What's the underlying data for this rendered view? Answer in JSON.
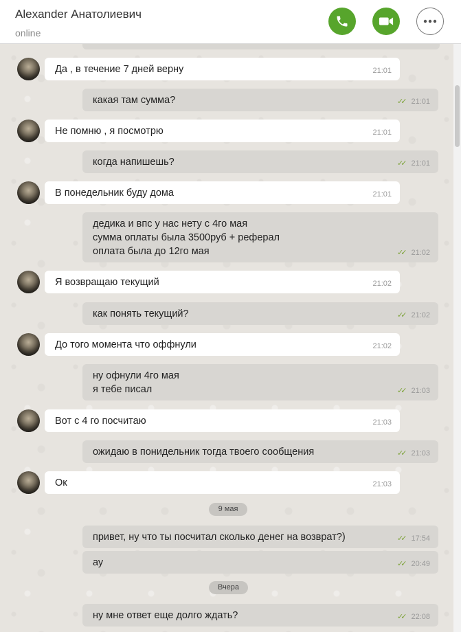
{
  "header": {
    "contact_name": "Alexander Анатолиевич",
    "status": "online",
    "call_icon": "phone-icon",
    "video_icon": "video-camera-icon",
    "more_icon": "more-dots-icon",
    "accent_color": "#57a52c"
  },
  "messages": [
    {
      "direction": "in",
      "text": "Да , в течение 7 дней верну",
      "time": "21:01"
    },
    {
      "direction": "out",
      "text": "какая там сумма?",
      "time": "21:01",
      "read": true
    },
    {
      "direction": "in",
      "text": "Не помню , я посмотрю",
      "time": "21:01"
    },
    {
      "direction": "out",
      "text": "когда напишешь?",
      "time": "21:01",
      "read": true
    },
    {
      "direction": "in",
      "text": "В понедельник буду дома",
      "time": "21:01"
    },
    {
      "direction": "out",
      "text": "дедика и впс у нас нету с 4го мая\nсумма оплаты была 3500руб + реферал\nоплата была до 12го мая",
      "time": "21:02",
      "read": true
    },
    {
      "direction": "in",
      "text": "Я возвращаю текущий",
      "time": "21:02"
    },
    {
      "direction": "out",
      "text": "как понять текущий?",
      "time": "21:02",
      "read": true
    },
    {
      "direction": "in",
      "text": "До того момента что оффнули",
      "time": "21:02"
    },
    {
      "direction": "out",
      "text": "ну офнули 4го мая\nя тебе писал",
      "time": "21:03",
      "read": true
    },
    {
      "direction": "in",
      "text": "Вот с 4 го посчитаю",
      "time": "21:03"
    },
    {
      "direction": "out",
      "text": "ожидаю в понидельник тогда твоего сообщения",
      "time": "21:03",
      "read": true
    },
    {
      "direction": "in",
      "text": "Ок",
      "time": "21:03"
    },
    {
      "direction": "out",
      "text": "привет, ну что ты посчитал сколько денег на возврат?)",
      "time": "17:54",
      "read": true
    },
    {
      "direction": "out",
      "text": "ау",
      "time": "20:49",
      "read": true
    },
    {
      "direction": "out",
      "text": "ну мне ответ еще долго ждать?",
      "time": "22:08",
      "read": true
    }
  ],
  "date_separators": [
    "9 мая",
    "Вчера"
  ]
}
